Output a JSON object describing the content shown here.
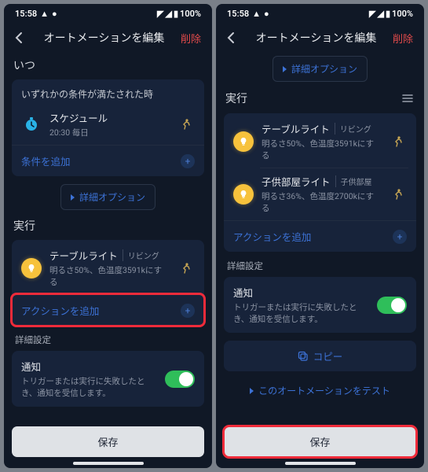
{
  "status": {
    "time": "15:58",
    "battery": "100%"
  },
  "header": {
    "title": "オートメーションを編集",
    "delete": "削除"
  },
  "when": {
    "title": "いつ",
    "head": "いずれかの条件が満たされた時",
    "schedule": {
      "title": "スケジュール",
      "sub": "20:30  毎日"
    },
    "add": "条件を追加"
  },
  "advanced": "詳細オプション",
  "run": {
    "title": "実行"
  },
  "actions": {
    "a1": {
      "title": "テーブルライト",
      "room": "リビング",
      "sub": "明るさ50%、色温度3591kにする"
    },
    "a2": {
      "title": "子供部屋ライト",
      "room": "子供部屋",
      "sub": "明るさ36%、色温度2700kにする"
    },
    "add": "アクションを追加"
  },
  "details": {
    "label": "詳細設定",
    "notify_title": "通知",
    "notify_sub": "トリガーまたは実行に失敗したとき、通知を受信します。"
  },
  "copy": "コピー",
  "test": "このオートメーションをテスト",
  "save": "保存"
}
